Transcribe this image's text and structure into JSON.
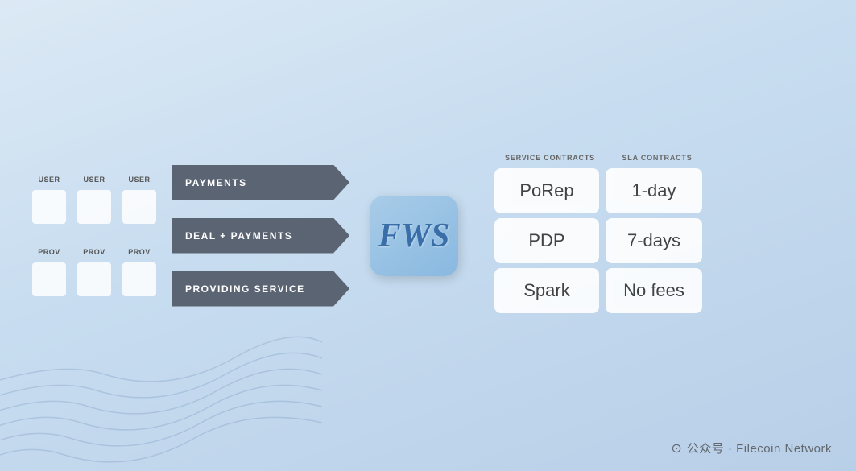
{
  "actors": {
    "user_label": "USER",
    "prov_label": "PROV",
    "user_count": 3,
    "prov_count": 3
  },
  "arrows": {
    "payments": "PAYMENTS",
    "deal_payments": "DEAL + PAYMENTS",
    "providing_service": "PROVIDING SERVICE"
  },
  "fws": {
    "label": "FWS"
  },
  "contracts": {
    "service_header": "SERVICE CONTRACTS",
    "sla_header": "SLA CONTRACTS",
    "rows": [
      {
        "service": "PoRep",
        "sla": "1-day"
      },
      {
        "service": "PDP",
        "sla": "7-days"
      },
      {
        "service": "Spark",
        "sla": "No fees"
      }
    ]
  },
  "watermark": {
    "icon": "⊙",
    "text": "公众号 · Filecoin Network"
  }
}
